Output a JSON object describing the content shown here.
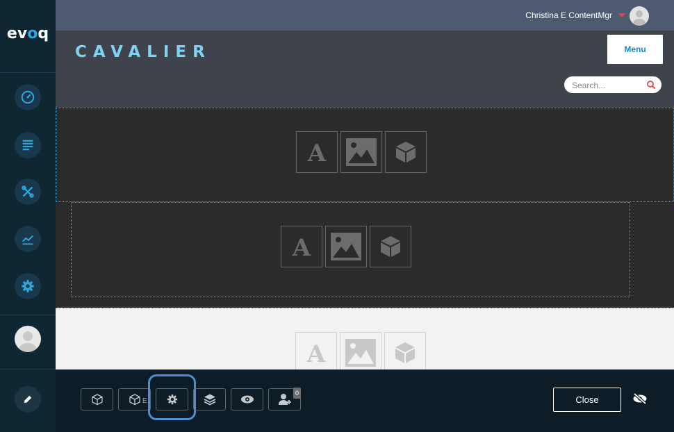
{
  "sidebar": {
    "logo": {
      "part1": "ev",
      "part2": "o",
      "part3": "q"
    },
    "items": [
      {
        "icon": "dashboard-gauge-icon"
      },
      {
        "icon": "content-list-icon"
      },
      {
        "icon": "tools-icon"
      },
      {
        "icon": "analytics-chart-icon"
      },
      {
        "icon": "settings-gear-icon"
      },
      {
        "icon": "user-avatar"
      },
      {
        "icon": "edit-pencil-icon"
      }
    ]
  },
  "topbar": {
    "username": "Christina E ContentMgr"
  },
  "header": {
    "brand": "CAVALIER",
    "menu_label": "Menu",
    "search_placeholder": "Search..."
  },
  "panes": [
    {
      "placeholders": [
        "text-icon",
        "image-icon",
        "module-box-icon"
      ],
      "glyph_text": "A"
    },
    {
      "placeholders": [
        "text-icon",
        "image-icon",
        "module-box-icon"
      ],
      "glyph_text": "A"
    },
    {
      "placeholders": [
        "text-icon",
        "image-icon",
        "module-box-icon"
      ],
      "glyph_text": "A"
    }
  ],
  "toolbar": {
    "buttons": [
      "module-icon",
      "existing-module-icon",
      "page-settings-icon",
      "layers-icon",
      "preview-eye-icon",
      "add-user-icon"
    ],
    "existing_module_sub": "E",
    "badge_count": "0",
    "close_label": "Close"
  },
  "colors": {
    "accent": "#2ea7df",
    "brand_text": "#7fd1f5",
    "focus_ring": "#4f8fd8",
    "caret": "#e0454c"
  }
}
